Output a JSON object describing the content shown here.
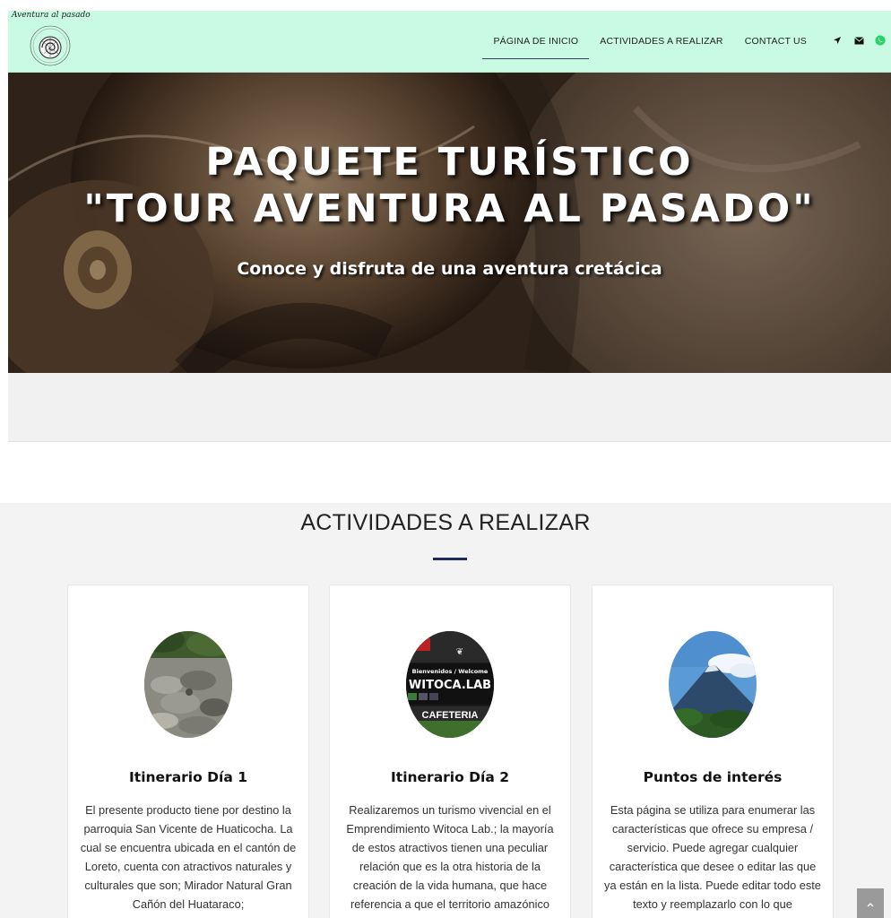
{
  "header": {
    "brand_script": "Aventura al pasado",
    "logo_icon": "ammonite-logo-icon",
    "nav": [
      {
        "label": "PÁGINA DE INICIO",
        "active": true
      },
      {
        "label": "ACTIVIDADES A REALIZAR",
        "active": false
      },
      {
        "label": "CONTACT US",
        "active": false
      }
    ],
    "icons": [
      "location-arrow-icon",
      "envelope-icon",
      "whatsapp-icon"
    ]
  },
  "hero": {
    "title_line1": "PAQUETE TURÍSTICO",
    "title_line2": "\"TOUR AVENTURA AL PASADO\"",
    "subtitle": "Conoce y disfruta de una aventura cretácica"
  },
  "section": {
    "title": "ACTIVIDADES A REALIZAR",
    "accent_color": "#1e2a5a"
  },
  "cards": [
    {
      "title": "Itinerario Día 1",
      "text": "El presente producto tiene por destino la parroquia San Vicente de Huaticocha. La cual se encuentra ubicada en el cantón de Loreto, cuenta con atractivos naturales y culturales que son; Mirador Natural Gran Cañón del Huataraco;",
      "image": "rocky-canyon-photo"
    },
    {
      "title": "Itinerario Día 2",
      "text": "Realizaremos un turismo vivencial en el Emprendimiento Witoca Lab.; la mayoría de estos atractivos tienen una peculiar relación que es la otra historia de la creación de la vida humana, que hace referencia a que el territorio amazónico",
      "image": "witoca-lab-sign-photo",
      "image_text": [
        "Bienvenidos / Welcome",
        "WITOCA.LAB",
        "CAFETERIA"
      ]
    },
    {
      "title": "Puntos de interés",
      "text": "Esta página se utiliza para enumerar las características que ofrece su empresa / servicio. Puede agregar cualquier característica que desee o editar las que ya están en la lista. Puede editar todo este texto y reemplazarlo con lo que",
      "image": "volcano-photo"
    }
  ],
  "scroll_top_icon": "chevron-up-icon"
}
